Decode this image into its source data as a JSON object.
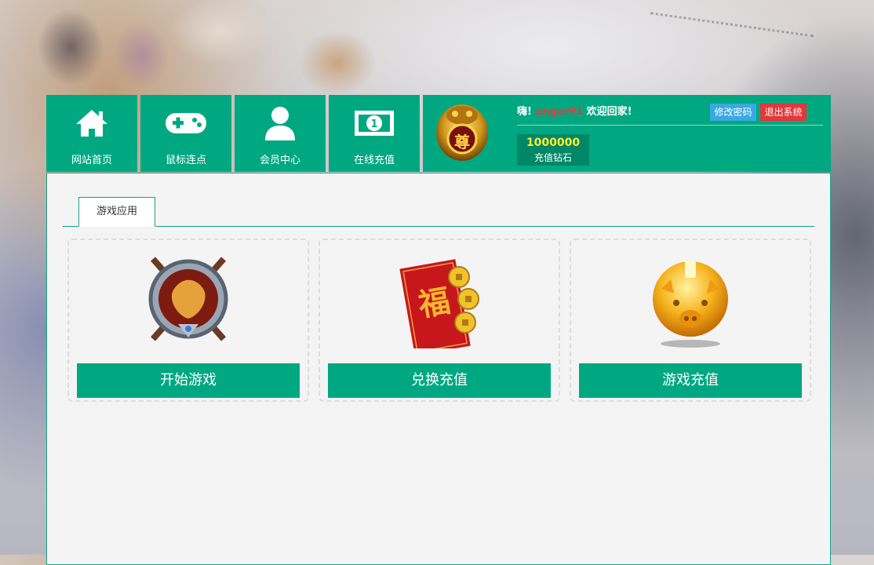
{
  "nav": {
    "items": [
      {
        "label": "网站首页",
        "icon": "home-icon"
      },
      {
        "label": "鼠标连点",
        "icon": "gamepad-icon"
      },
      {
        "label": "会员中心",
        "icon": "user-icon"
      },
      {
        "label": "在线充值",
        "icon": "money-icon"
      }
    ]
  },
  "user": {
    "greeting_prefix": "嗨!",
    "username": "angar91",
    "greeting_suffix": "欢迎回家!",
    "change_password_label": "修改密码",
    "logout_label": "退出系统",
    "balance_value": "1000000",
    "balance_label": "充值钻石",
    "avatar_badge_text": "尊"
  },
  "tabs": [
    {
      "label": "游戏应用"
    }
  ],
  "cards": [
    {
      "action_label": "开始游戏",
      "icon": "crossed-swords-emblem-icon"
    },
    {
      "action_label": "兑换充值",
      "icon": "red-envelope-coins-icon"
    },
    {
      "action_label": "游戏充值",
      "icon": "piggy-bank-icon"
    }
  ],
  "colors": {
    "primary": "#00a882",
    "primary_dark": "#008768",
    "danger": "#e5363a",
    "info": "#3aa9e0",
    "username": "#e83a3a",
    "balance": "#ffef2f"
  }
}
